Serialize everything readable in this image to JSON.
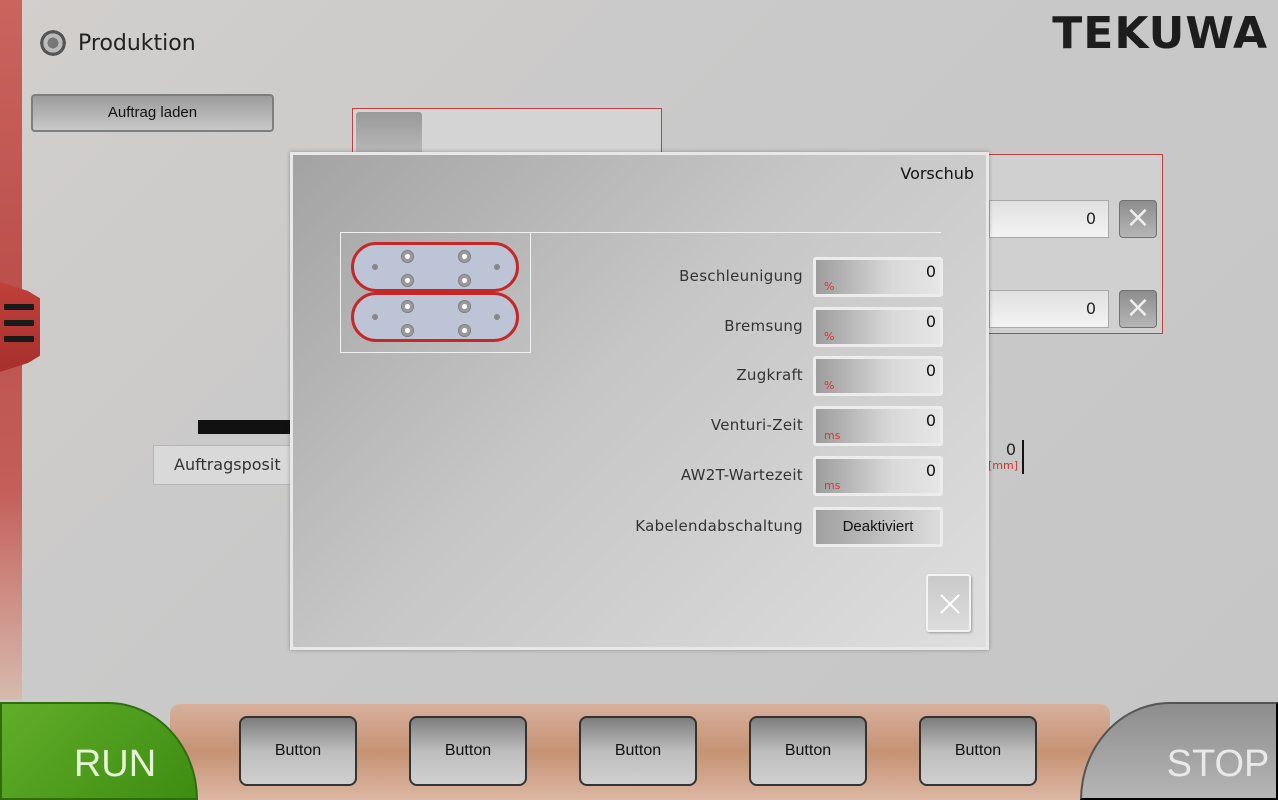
{
  "header": {
    "title": "Produktion",
    "logo": "TEKUWA",
    "icon": "gear-icon"
  },
  "toolbar": {
    "load_order": "Auftrag laden"
  },
  "background": {
    "field_values": [
      "0",
      "0"
    ],
    "readout_value": "0",
    "readout_unit": "[mm]",
    "position_label": "Auftragsposit"
  },
  "modal": {
    "title": "Vorschub",
    "rows": [
      {
        "label": "Beschleunigung",
        "value": "0",
        "unit": "%"
      },
      {
        "label": "Bremsung",
        "value": "0",
        "unit": "%"
      },
      {
        "label": "Zugkraft",
        "value": "0",
        "unit": "%"
      },
      {
        "label": "Venturi-Zeit",
        "value": "0",
        "unit": "ms"
      },
      {
        "label": "AW2T-Wartezeit",
        "value": "0",
        "unit": "ms"
      }
    ],
    "cable_end": {
      "label": "Kabelendabschaltung",
      "value": "Deaktiviert"
    }
  },
  "bottom": {
    "run": "RUN",
    "stop": "STOP",
    "buttons": [
      "Button",
      "Button",
      "Button",
      "Button",
      "Button"
    ]
  },
  "colors": {
    "accent_red": "#c42828",
    "run_green": "#4f9c1e"
  }
}
